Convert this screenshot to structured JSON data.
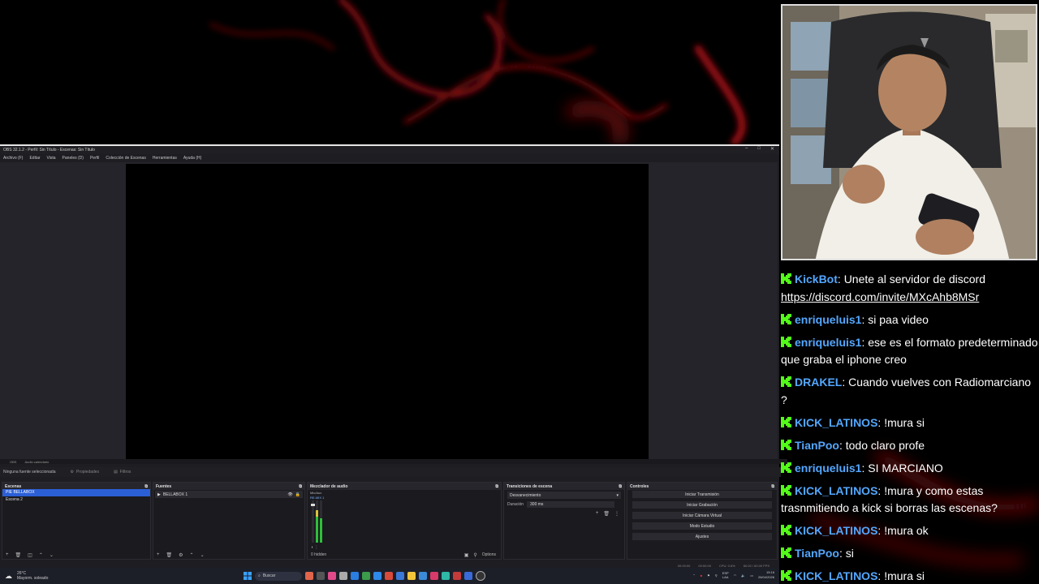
{
  "colors": {
    "username": "#53a7ff",
    "kick_green": "#53fc18",
    "selection_blue": "#2b5fd6"
  },
  "obs": {
    "title": "OBS 32.1.2 - Perfil: Sin Título - Escenas: Sin Título",
    "menu": [
      "Archivo (F)",
      "Editar",
      "Vista",
      "Paneles (D)",
      "Perfil",
      "Colección de Escenas",
      "Herramientas",
      "Ayuda (H)"
    ],
    "preview_tabs": [
      "OBS",
      "Audio calendario"
    ],
    "source_toolbar": {
      "no_source": "Ninguna fuente seleccionada",
      "properties": "Propiedades",
      "filters": "Filtros"
    },
    "scenes": {
      "title": "Escenas",
      "items": [
        "PIE BELLABOX",
        "Escena 2"
      ]
    },
    "sources": {
      "title": "Fuentes",
      "items": [
        "BELLABOX 1"
      ]
    },
    "mixer": {
      "title": "Mezclador de audio",
      "channel": "Mic/Aux",
      "badge": "RE-MIX 1",
      "hidden": "0 hidden",
      "options": "Options"
    },
    "transitions": {
      "title": "Transiciones de escena",
      "selected": "Desvanecimiento",
      "duration_label": "Duración",
      "duration_value": "300 ms"
    },
    "controls": {
      "title": "Controles",
      "buttons": [
        "Iniciar Transmisión",
        "Iniciar Grabación",
        "Iniciar Cámara Virtual",
        "Modo Estudio",
        "Ajustes"
      ]
    },
    "status": {
      "rec": "00:00:00",
      "stream": "00:00:00",
      "cpu": "CPU: 0.6%",
      "fps": "60.00 / 60.00 FPS"
    }
  },
  "taskbar": {
    "weather_temp": "26°C",
    "weather_text": "Mayorm. soleado",
    "search": "Buscar",
    "lang": "ESP",
    "lang2": "LAA",
    "time": "15:16",
    "date": "26/04/2026"
  },
  "chat": {
    "messages": [
      {
        "user": "KickBot",
        "text": "Unete al servidor de discord",
        "link": "https://discord.com/invite/MXcAhb8MSr"
      },
      {
        "user": "enriqueluis1",
        "text": "si paa video"
      },
      {
        "user": "enriqueluis1",
        "text": "ese es el formato predeterminado que graba el iphone creo"
      },
      {
        "user": "DRAKEL",
        "text": "Cuando vuelves con Radiomarciano ?"
      },
      {
        "user": "KICK_LATINOS",
        "text": "!mura si"
      },
      {
        "user": "TianPoo",
        "text": "todo claro profe"
      },
      {
        "user": "enriqueluis1",
        "text": "SI MARCIANO"
      },
      {
        "user": "KICK_LATINOS",
        "text": "!mura y como estas trasnmitiendo a kick si borras las escenas?"
      },
      {
        "user": "KICK_LATINOS",
        "text": "!mura ok"
      },
      {
        "user": "TianPoo",
        "text": "si"
      },
      {
        "user": "KICK_LATINOS",
        "text": "!mura si"
      }
    ]
  }
}
